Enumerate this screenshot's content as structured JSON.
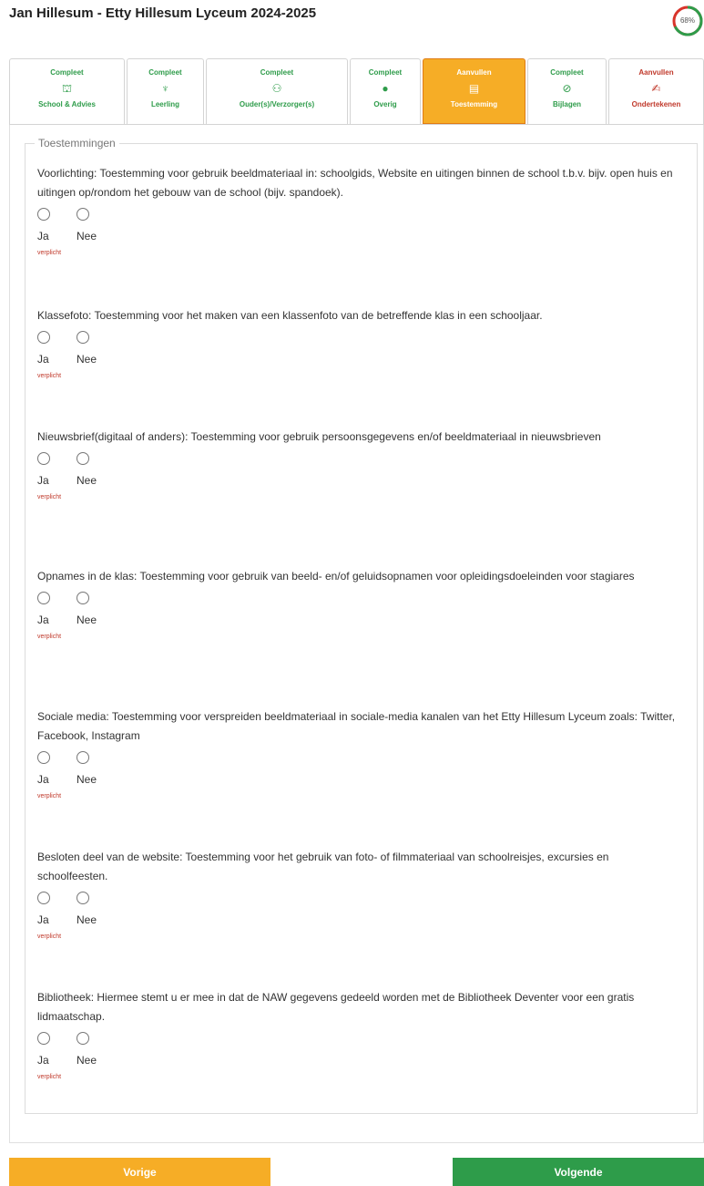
{
  "header": {
    "title": "Jan Hillesum - Etty Hillesum Lyceum 2024-2025",
    "progress": {
      "label": "68%",
      "value": 0.68,
      "color_done": "#2e9c4a",
      "color_remaining": "#d9342b"
    }
  },
  "tabs": [
    {
      "status": "Compleet",
      "icon": "school-icon",
      "glyph": "⛫",
      "label": "School & Advies",
      "state": "done"
    },
    {
      "status": "Compleet",
      "icon": "person-icon",
      "glyph": "♆",
      "label": "Leerling",
      "state": "done"
    },
    {
      "status": "Compleet",
      "icon": "people-icon",
      "glyph": "⚇",
      "label": "Ouder(s)/Verzorger(s)",
      "state": "done"
    },
    {
      "status": "Compleet",
      "icon": "info-icon",
      "glyph": "●",
      "label": "Overig",
      "state": "done"
    },
    {
      "status": "Aanvullen",
      "icon": "list-icon",
      "glyph": "▤",
      "label": "Toestemming",
      "state": "active"
    },
    {
      "status": "Compleet",
      "icon": "paperclip-icon",
      "glyph": "⊘",
      "label": "Bijlagen",
      "state": "done"
    },
    {
      "status": "Aanvullen",
      "icon": "signature-icon",
      "glyph": "✍",
      "label": "Ondertekenen",
      "state": "todo"
    }
  ],
  "section": {
    "legend": "Toestemmingen"
  },
  "questions": [
    {
      "text": "Voorlichting: Toestemming voor gebruik beeldmateriaal in: schoolgids, Website en uitingen binnen de school t.b.v. bijv. open huis en uitingen op/rondom het gebouw van de school (bijv. spandoek)."
    },
    {
      "text": "Klassefoto: Toestemming voor het maken van een klassenfoto van de betreffende klas in een schooljaar."
    },
    {
      "text": "Nieuwsbrief(digitaal of anders): Toestemming voor gebruik persoonsgegevens en/of beeldmateriaal in nieuwsbrieven"
    },
    {
      "text": "Opnames in de klas: Toestemming voor gebruik van beeld- en/of geluidsopnamen voor opleidingsdoeleinden voor stagiares"
    },
    {
      "text": "Sociale media: Toestemming voor verspreiden beeldmateriaal in sociale-media kanalen van het Etty Hillesum Lyceum zoals: Twitter, Facebook, Instagram"
    },
    {
      "text": "Besloten deel van de website: Toestemming voor het gebruik van foto- of filmmateriaal van schoolreisjes, excursies en schoolfeesten."
    },
    {
      "text": "Bibliotheek: Hiermee stemt u er mee in dat de NAW gegevens gedeeld worden met de Bibliotheek Deventer voor een gratis lidmaatschap."
    }
  ],
  "options": {
    "yes": "Ja",
    "no": "Nee",
    "required": "verplicht"
  },
  "buttons": {
    "prev": "Vorige",
    "next": "Volgende"
  }
}
